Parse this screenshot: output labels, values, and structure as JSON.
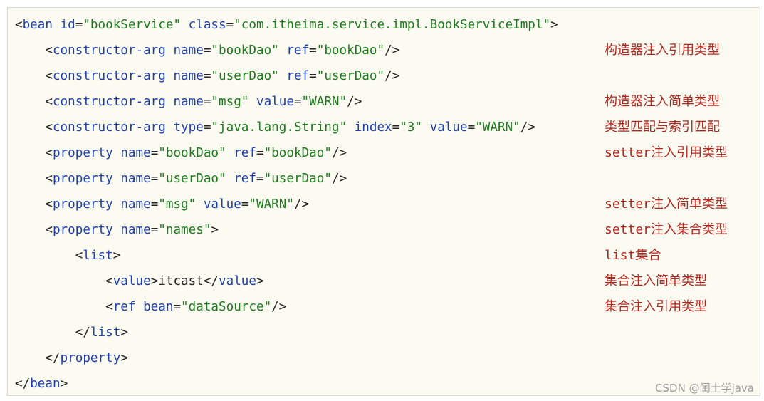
{
  "code_lines": [
    [
      {
        "t": "<",
        "k": "punct"
      },
      {
        "t": "bean",
        "k": "tag"
      },
      {
        "t": " ",
        "k": "text"
      },
      {
        "t": "id",
        "k": "attr"
      },
      {
        "t": "=",
        "k": "eq"
      },
      {
        "t": "\"bookService\"",
        "k": "val"
      },
      {
        "t": " ",
        "k": "text"
      },
      {
        "t": "class",
        "k": "attr"
      },
      {
        "t": "=",
        "k": "eq"
      },
      {
        "t": "\"com.itheima.service.impl.BookServiceImpl\"",
        "k": "val"
      },
      {
        "t": ">",
        "k": "punct"
      }
    ],
    [
      {
        "t": "    <",
        "k": "punct"
      },
      {
        "t": "constructor-arg",
        "k": "tag"
      },
      {
        "t": " ",
        "k": "text"
      },
      {
        "t": "name",
        "k": "attr"
      },
      {
        "t": "=",
        "k": "eq"
      },
      {
        "t": "\"bookDao\"",
        "k": "val"
      },
      {
        "t": " ",
        "k": "text"
      },
      {
        "t": "ref",
        "k": "attr"
      },
      {
        "t": "=",
        "k": "eq"
      },
      {
        "t": "\"bookDao\"",
        "k": "val"
      },
      {
        "t": "/>",
        "k": "punct"
      }
    ],
    [
      {
        "t": "    <",
        "k": "punct"
      },
      {
        "t": "constructor-arg",
        "k": "tag"
      },
      {
        "t": " ",
        "k": "text"
      },
      {
        "t": "name",
        "k": "attr"
      },
      {
        "t": "=",
        "k": "eq"
      },
      {
        "t": "\"userDao\"",
        "k": "val"
      },
      {
        "t": " ",
        "k": "text"
      },
      {
        "t": "ref",
        "k": "attr"
      },
      {
        "t": "=",
        "k": "eq"
      },
      {
        "t": "\"userDao\"",
        "k": "val"
      },
      {
        "t": "/>",
        "k": "punct"
      }
    ],
    [
      {
        "t": "    <",
        "k": "punct"
      },
      {
        "t": "constructor-arg",
        "k": "tag"
      },
      {
        "t": " ",
        "k": "text"
      },
      {
        "t": "name",
        "k": "attr"
      },
      {
        "t": "=",
        "k": "eq"
      },
      {
        "t": "\"msg\"",
        "k": "val"
      },
      {
        "t": " ",
        "k": "text"
      },
      {
        "t": "value",
        "k": "attr"
      },
      {
        "t": "=",
        "k": "eq"
      },
      {
        "t": "\"WARN\"",
        "k": "val"
      },
      {
        "t": "/>",
        "k": "punct"
      }
    ],
    [
      {
        "t": "    <",
        "k": "punct"
      },
      {
        "t": "constructor-arg",
        "k": "tag"
      },
      {
        "t": " ",
        "k": "text"
      },
      {
        "t": "type",
        "k": "attr"
      },
      {
        "t": "=",
        "k": "eq"
      },
      {
        "t": "\"java.lang.String\"",
        "k": "val"
      },
      {
        "t": " ",
        "k": "text"
      },
      {
        "t": "index",
        "k": "attr"
      },
      {
        "t": "=",
        "k": "eq"
      },
      {
        "t": "\"3\"",
        "k": "val"
      },
      {
        "t": " ",
        "k": "text"
      },
      {
        "t": "value",
        "k": "attr"
      },
      {
        "t": "=",
        "k": "eq"
      },
      {
        "t": "\"WARN\"",
        "k": "val"
      },
      {
        "t": "/>",
        "k": "punct"
      }
    ],
    [
      {
        "t": "    <",
        "k": "punct"
      },
      {
        "t": "property",
        "k": "tag"
      },
      {
        "t": " ",
        "k": "text"
      },
      {
        "t": "name",
        "k": "attr"
      },
      {
        "t": "=",
        "k": "eq"
      },
      {
        "t": "\"bookDao\"",
        "k": "val"
      },
      {
        "t": " ",
        "k": "text"
      },
      {
        "t": "ref",
        "k": "attr"
      },
      {
        "t": "=",
        "k": "eq"
      },
      {
        "t": "\"bookDao\"",
        "k": "val"
      },
      {
        "t": "/>",
        "k": "punct"
      }
    ],
    [
      {
        "t": "    <",
        "k": "punct"
      },
      {
        "t": "property",
        "k": "tag"
      },
      {
        "t": " ",
        "k": "text"
      },
      {
        "t": "name",
        "k": "attr"
      },
      {
        "t": "=",
        "k": "eq"
      },
      {
        "t": "\"userDao\"",
        "k": "val"
      },
      {
        "t": " ",
        "k": "text"
      },
      {
        "t": "ref",
        "k": "attr"
      },
      {
        "t": "=",
        "k": "eq"
      },
      {
        "t": "\"userDao\"",
        "k": "val"
      },
      {
        "t": "/>",
        "k": "punct"
      }
    ],
    [
      {
        "t": "    <",
        "k": "punct"
      },
      {
        "t": "property",
        "k": "tag"
      },
      {
        "t": " ",
        "k": "text"
      },
      {
        "t": "name",
        "k": "attr"
      },
      {
        "t": "=",
        "k": "eq"
      },
      {
        "t": "\"msg\"",
        "k": "val"
      },
      {
        "t": " ",
        "k": "text"
      },
      {
        "t": "value",
        "k": "attr"
      },
      {
        "t": "=",
        "k": "eq"
      },
      {
        "t": "\"WARN\"",
        "k": "val"
      },
      {
        "t": "/>",
        "k": "punct"
      }
    ],
    [
      {
        "t": "    <",
        "k": "punct"
      },
      {
        "t": "property",
        "k": "tag"
      },
      {
        "t": " ",
        "k": "text"
      },
      {
        "t": "name",
        "k": "attr"
      },
      {
        "t": "=",
        "k": "eq"
      },
      {
        "t": "\"names\"",
        "k": "val"
      },
      {
        "t": ">",
        "k": "punct"
      }
    ],
    [
      {
        "t": "        <",
        "k": "punct"
      },
      {
        "t": "list",
        "k": "tag"
      },
      {
        "t": ">",
        "k": "punct"
      }
    ],
    [
      {
        "t": "            <",
        "k": "punct"
      },
      {
        "t": "value",
        "k": "tag"
      },
      {
        "t": ">",
        "k": "punct"
      },
      {
        "t": "itcast",
        "k": "text"
      },
      {
        "t": "</",
        "k": "punct"
      },
      {
        "t": "value",
        "k": "tag"
      },
      {
        "t": ">",
        "k": "punct"
      }
    ],
    [
      {
        "t": "            <",
        "k": "punct"
      },
      {
        "t": "ref",
        "k": "tag"
      },
      {
        "t": " ",
        "k": "text"
      },
      {
        "t": "bean",
        "k": "attr"
      },
      {
        "t": "=",
        "k": "eq"
      },
      {
        "t": "\"dataSource\"",
        "k": "val"
      },
      {
        "t": "/>",
        "k": "punct"
      }
    ],
    [
      {
        "t": "        </",
        "k": "punct"
      },
      {
        "t": "list",
        "k": "tag"
      },
      {
        "t": ">",
        "k": "punct"
      }
    ],
    [
      {
        "t": "    </",
        "k": "punct"
      },
      {
        "t": "property",
        "k": "tag"
      },
      {
        "t": ">",
        "k": "punct"
      }
    ],
    [
      {
        "t": "</",
        "k": "punct"
      },
      {
        "t": "bean",
        "k": "tag"
      },
      {
        "t": ">",
        "k": "punct"
      }
    ]
  ],
  "annotations": [
    {
      "line": 1,
      "text": "构造器注入引用类型"
    },
    {
      "line": 3,
      "text": "构造器注入简单类型"
    },
    {
      "line": 4,
      "text": "类型匹配与索引匹配"
    },
    {
      "line": 5,
      "text": "setter注入引用类型"
    },
    {
      "line": 7,
      "text": "setter注入简单类型"
    },
    {
      "line": 8,
      "text": "setter注入集合类型"
    },
    {
      "line": 9,
      "text": "list集合"
    },
    {
      "line": 10,
      "text": "集合注入简单类型"
    },
    {
      "line": 11,
      "text": "集合注入引用类型"
    }
  ],
  "watermark": "CSDN @闰土学java",
  "colors": {
    "background": "#fbfbf2",
    "tag": "#1f3fa8",
    "attribute_value": "#1d7a1d",
    "annotation": "#b3261e"
  }
}
